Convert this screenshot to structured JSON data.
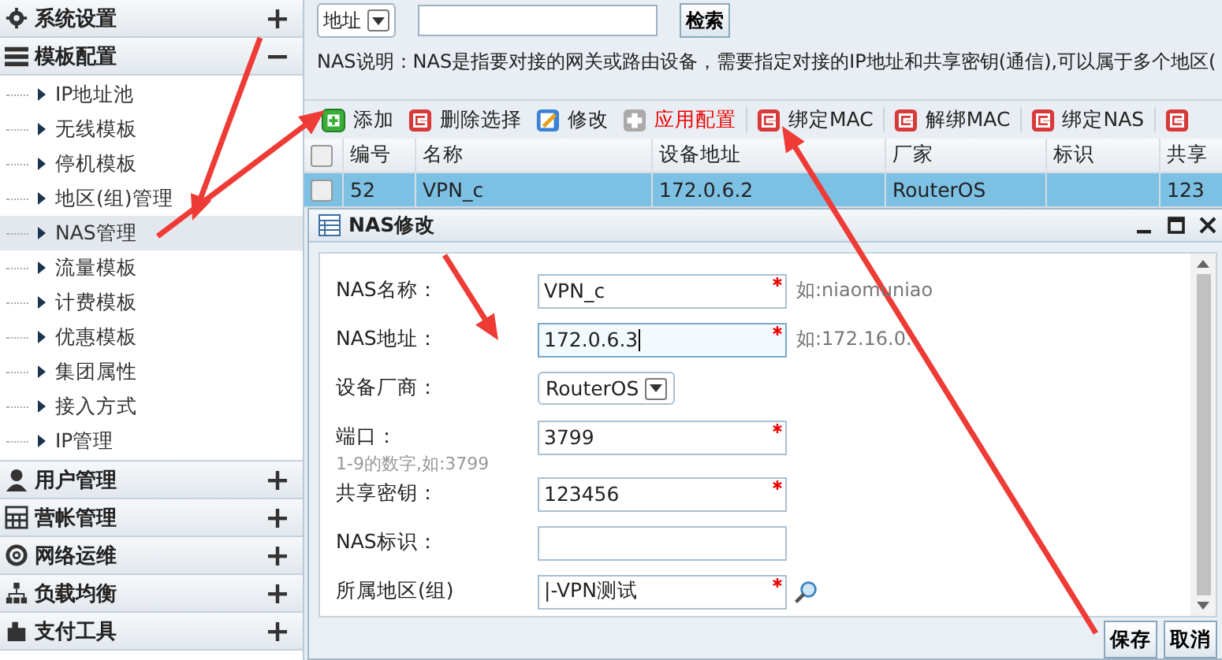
{
  "sidebar": {
    "sections": [
      {
        "title": "系统设置",
        "expanded": false
      },
      {
        "title": "模板配置",
        "expanded": true,
        "items": [
          {
            "label": "IP地址池",
            "selected": false
          },
          {
            "label": "无线模板",
            "selected": false
          },
          {
            "label": "停机模板",
            "selected": false
          },
          {
            "label": "地区(组)管理",
            "selected": false
          },
          {
            "label": "NAS管理",
            "selected": true
          },
          {
            "label": "流量模板",
            "selected": false
          },
          {
            "label": "计费模板",
            "selected": false
          },
          {
            "label": "优惠模板",
            "selected": false
          },
          {
            "label": "集团属性",
            "selected": false
          },
          {
            "label": "接入方式",
            "selected": false
          },
          {
            "label": "IP管理",
            "selected": false
          }
        ]
      },
      {
        "title": "用户管理",
        "expanded": false
      },
      {
        "title": "营帐管理",
        "expanded": false
      },
      {
        "title": "网络运维",
        "expanded": false
      },
      {
        "title": "负载均衡",
        "expanded": false
      },
      {
        "title": "支付工具",
        "expanded": false
      }
    ]
  },
  "search": {
    "field": "地址",
    "button": "检索"
  },
  "description": "NAS说明：NAS是指要对接的网关或路由设备，需要指定对接的IP地址和共享密钥(通信),可以属于多个地区(",
  "toolbar": [
    {
      "label": "添加",
      "highlight": false
    },
    {
      "label": "删除选择",
      "highlight": false
    },
    {
      "label": "修改",
      "highlight": false
    },
    {
      "label": "应用配置",
      "highlight": true
    },
    {
      "label": "绑定MAC",
      "highlight": false
    },
    {
      "label": "解绑MAC",
      "highlight": false
    },
    {
      "label": "绑定NAS",
      "highlight": false
    }
  ],
  "table": {
    "header_checked": false,
    "columns": [
      "编号",
      "名称",
      "设备地址",
      "厂家",
      "标识",
      "共享"
    ],
    "rows": [
      {
        "cells": [
          "52",
          "VPN_c",
          "172.0.6.2",
          "RouterOS",
          "",
          "123"
        ],
        "selected": true,
        "checked": false
      }
    ]
  },
  "dialog": {
    "title": "NAS修改",
    "fields": [
      {
        "kind": "text",
        "label": "NAS名称：",
        "value": "VPN_c",
        "required": true,
        "focused": false,
        "hint": "如:niaomuniao"
      },
      {
        "kind": "text",
        "label": "NAS地址：",
        "value": "172.0.6.3",
        "required": true,
        "focused": true,
        "hint": "如:172.16.0."
      },
      {
        "kind": "select",
        "label": "设备厂商：",
        "value": "RouterOS"
      },
      {
        "kind": "text",
        "label": "端口：",
        "value": "3799",
        "required": true,
        "focused": false,
        "note": "1-9的数字,如:3799"
      },
      {
        "kind": "text",
        "label": "共享密钥：",
        "value": "123456",
        "required": true,
        "focused": false
      },
      {
        "kind": "text",
        "label": "NAS标识：",
        "focused": false
      },
      {
        "kind": "lookup",
        "label": "所属地区(组)",
        "value": "|-VPN测试",
        "required": true,
        "focused": false
      }
    ],
    "buttons": [
      "保存",
      "取消"
    ]
  }
}
